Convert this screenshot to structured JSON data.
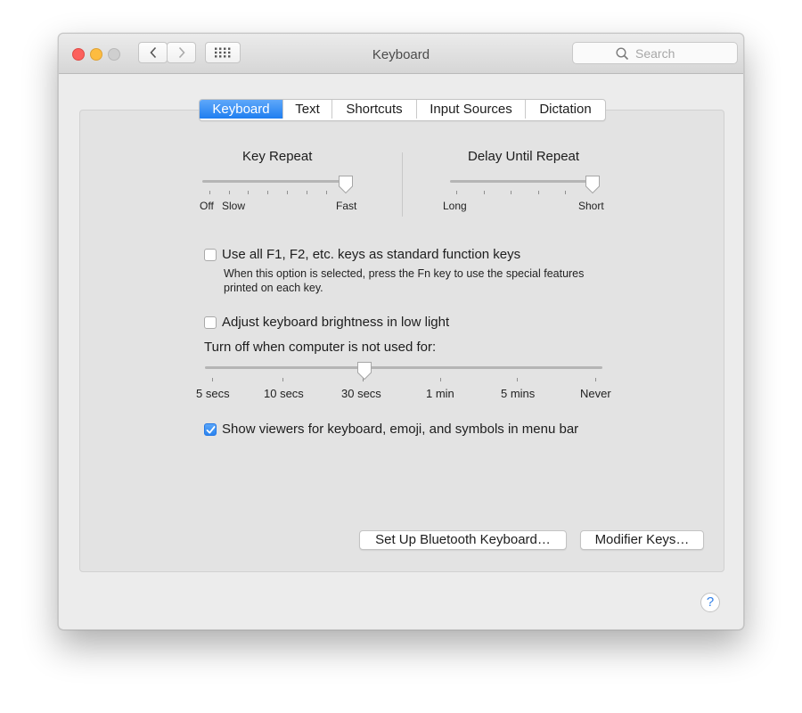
{
  "window": {
    "title": "Keyboard",
    "search_placeholder": "Search"
  },
  "tabs": [
    {
      "label": "Keyboard",
      "active": true
    },
    {
      "label": "Text",
      "active": false
    },
    {
      "label": "Shortcuts",
      "active": false
    },
    {
      "label": "Input Sources",
      "active": false
    },
    {
      "label": "Dictation",
      "active": false
    }
  ],
  "key_repeat": {
    "label": "Key Repeat",
    "tick_labels": [
      "Off",
      "Slow",
      "Fast"
    ],
    "value_fraction": 1.0
  },
  "delay_until_repeat": {
    "label": "Delay Until Repeat",
    "tick_labels": [
      "Long",
      "Short"
    ],
    "value_fraction": 1.0
  },
  "function_keys": {
    "label": "Use all F1, F2, etc. keys as standard function keys",
    "checked": false,
    "description_line1": "When this option is selected, press the Fn key to use the special features",
    "description_line2": "printed on each key."
  },
  "brightness": {
    "label": "Adjust keyboard brightness in low light",
    "checked": false
  },
  "backlight_timeout": {
    "label": "Turn off when computer is not used for:",
    "tick_labels": [
      "5 secs",
      "10 secs",
      "30 secs",
      "1 min",
      "5 mins",
      "Never"
    ],
    "selected": "30 secs"
  },
  "viewers": {
    "label": "Show viewers for keyboard, emoji, and symbols in menu bar",
    "checked": true
  },
  "buttons": {
    "bluetooth": "Set Up Bluetooth Keyboard…",
    "modifier": "Modifier Keys…",
    "help": "?"
  },
  "colors": {
    "accent": "#1f7ef0",
    "close": "#fc605c",
    "minimize": "#fdbc40",
    "zoom_disabled": "#cfcfcf"
  },
  "icons": [
    "chevron-left-icon",
    "chevron-right-icon",
    "grid-icon",
    "search-icon",
    "checkmark-icon"
  ]
}
